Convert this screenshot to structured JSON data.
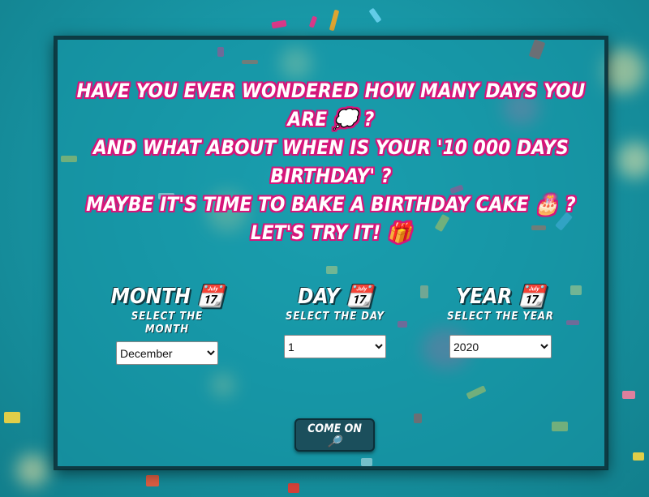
{
  "headline": {
    "line1": "Have you ever wondered how many days you are 💭 ?",
    "line2": "And what about when is your '10 000 days birthday' ?",
    "line3": "Maybe it's time to bake a birthday cake 🎂 ?",
    "line4": "Let's try it! 🎁"
  },
  "month": {
    "title": "Month",
    "icon": "📆",
    "subtitle": "Select the month",
    "selected": "December"
  },
  "day": {
    "title": "Day",
    "icon": "📆",
    "subtitle": "Select the day",
    "selected": "1"
  },
  "year": {
    "title": "Year",
    "icon": "📆",
    "subtitle": "Select the year",
    "selected": "2020"
  },
  "button": {
    "label": "Come on 🔎"
  },
  "colors": {
    "title_outline": "#d6157a",
    "panel_border": "#0d3b44",
    "button_bg": "#1b4f5c"
  }
}
